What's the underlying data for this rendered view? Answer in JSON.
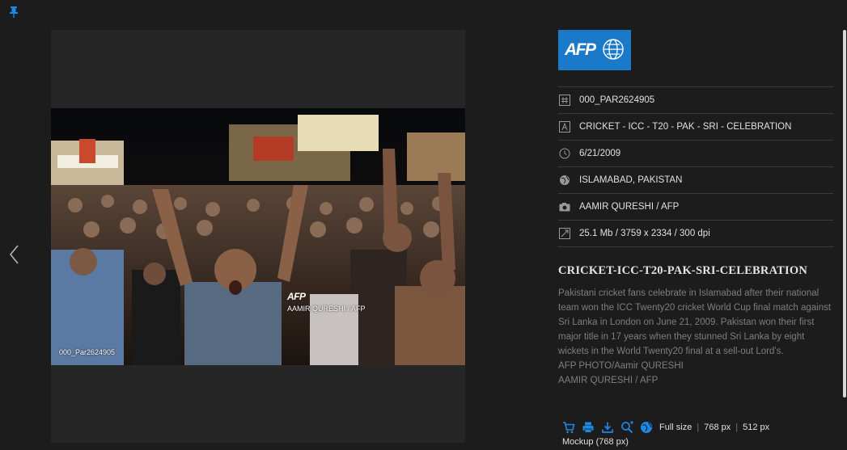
{
  "viewer": {
    "watermark_logo": "AFP",
    "watermark_credit": "AAMIR QURESHI / AFP",
    "watermark_id": "000_Par2624905"
  },
  "meta": {
    "logo_text": "AFP",
    "rows": [
      {
        "icon": "hash-icon",
        "value": "000_PAR2624905"
      },
      {
        "icon": "text-icon",
        "value": "CRICKET - ICC - T20 - PAK - SRI - CELEBRATION"
      },
      {
        "icon": "clock-icon",
        "value": "6/21/2009"
      },
      {
        "icon": "globe-icon",
        "value": "ISLAMABAD, PAKISTAN"
      },
      {
        "icon": "camera-icon",
        "value": "AAMIR QURESHI / AFP"
      },
      {
        "icon": "resize-icon",
        "value": "25.1 Mb / 3759 x 2334 / 300 dpi"
      }
    ],
    "title": "CRICKET-ICC-T20-PAK-SRI-CELEBRATION",
    "caption": "Pakistani cricket fans celebrate in Islamabad after their national team won the ICC Twenty20 cricket World Cup final match against Sri Lanka in London on June 21, 2009. Pakistan won their first major title in 17 years when they stunned Sri Lanka by eight wickets in the World Twenty20 final at a sell-out Lord's.",
    "caption_photo": "AFP PHOTO/Aamir QURESHI",
    "caption_credit": "AAMIR QURESHI / AFP"
  },
  "actions": {
    "tools": [
      "cart-icon",
      "print-icon",
      "download-icon",
      "zoom-icon",
      "globe-icon"
    ],
    "full_size": "Full size",
    "size_768": "768 px",
    "size_512": "512 px",
    "sep": "|",
    "mockup": "Mockup (768 px)"
  },
  "colors": {
    "accent": "#1a79c9",
    "background": "#1c1c1d",
    "caption": "#7e7e80"
  }
}
